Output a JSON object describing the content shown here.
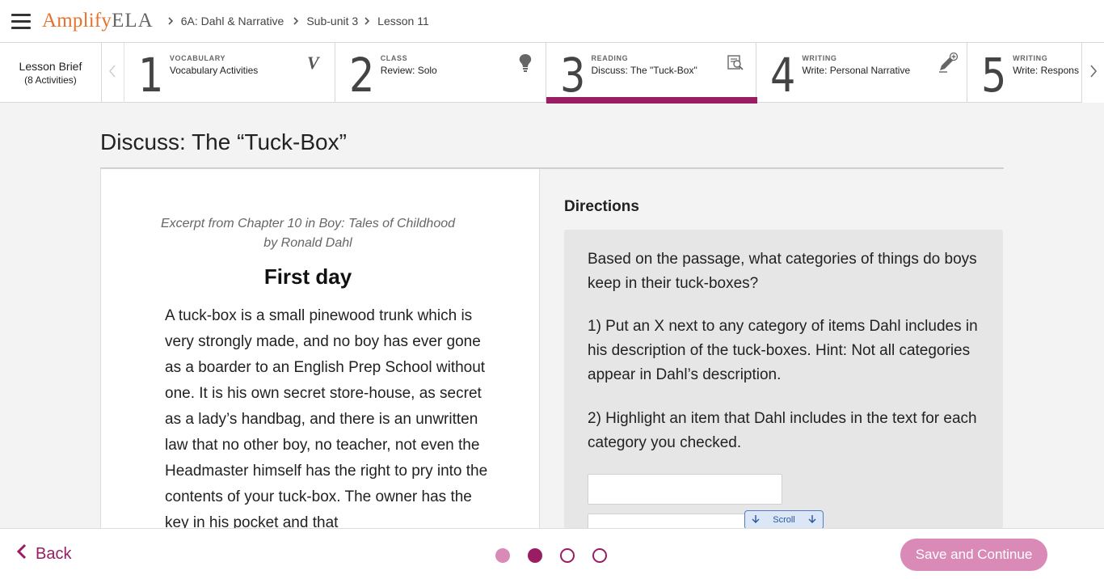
{
  "header": {
    "logo_amplify": "Amplify",
    "logo_ela": "ELA",
    "breadcrumbs": [
      "6A: Dahl & Narrative",
      "Sub-unit 3",
      "Lesson 11"
    ]
  },
  "lesson_brief": {
    "title": "Lesson Brief",
    "count": "(8 Activities)"
  },
  "activities": [
    {
      "number": "1",
      "category": "VOCABULARY",
      "title": "Vocabulary Activities",
      "icon": "vocabulary-v-icon"
    },
    {
      "number": "2",
      "category": "CLASS",
      "title": "Review: Solo",
      "icon": "lightbulb-icon"
    },
    {
      "number": "3",
      "category": "READING",
      "title": "Discuss: The \"Tuck-Box\"",
      "icon": "reading-search-icon",
      "active": true
    },
    {
      "number": "4",
      "category": "WRITING",
      "title": "Write: Personal Narrative",
      "icon": "pencil-plus-icon"
    },
    {
      "number": "5",
      "category": "WRITING",
      "title": "Write: Respons",
      "icon": ""
    }
  ],
  "page": {
    "title": "Discuss: The “Tuck-Box”"
  },
  "reading": {
    "excerpt_line1": "Excerpt from Chapter 10 in Boy: Tales of Childhood",
    "excerpt_line2": "by Ronald Dahl",
    "chapter_title": "First day",
    "passage": "A tuck-box is a small pinewood trunk which is very strongly made, and no boy has ever gone as a boarder to an English Prep School without one. It is his own secret store-house, as secret as a lady’s handbag, and there is an unwritten law that no other boy, no teacher, not even the Headmaster himself has the right to pry into the contents of your tuck-box. The owner has the key in his pocket and that"
  },
  "directions": {
    "heading": "Directions",
    "p1": "Based on the passage, what categories of things do boys keep in their tuck-boxes?",
    "p2": "1) Put an X next to any category of items Dahl includes in his description of the tuck-boxes. Hint: Not all categories appear in Dahl’s description.",
    "p3": "2) Highlight an item that Dahl includes in the text for each category you checked."
  },
  "scroll_button": {
    "label": "Scroll"
  },
  "footer": {
    "back_label": "Back",
    "save_label": "Save and Continue",
    "progress": {
      "total": 4,
      "completed": 1,
      "current": 2
    }
  },
  "colors": {
    "brand_orange": "#e8722c",
    "accent_magenta": "#9a1c63",
    "accent_light": "#d98ab6"
  }
}
